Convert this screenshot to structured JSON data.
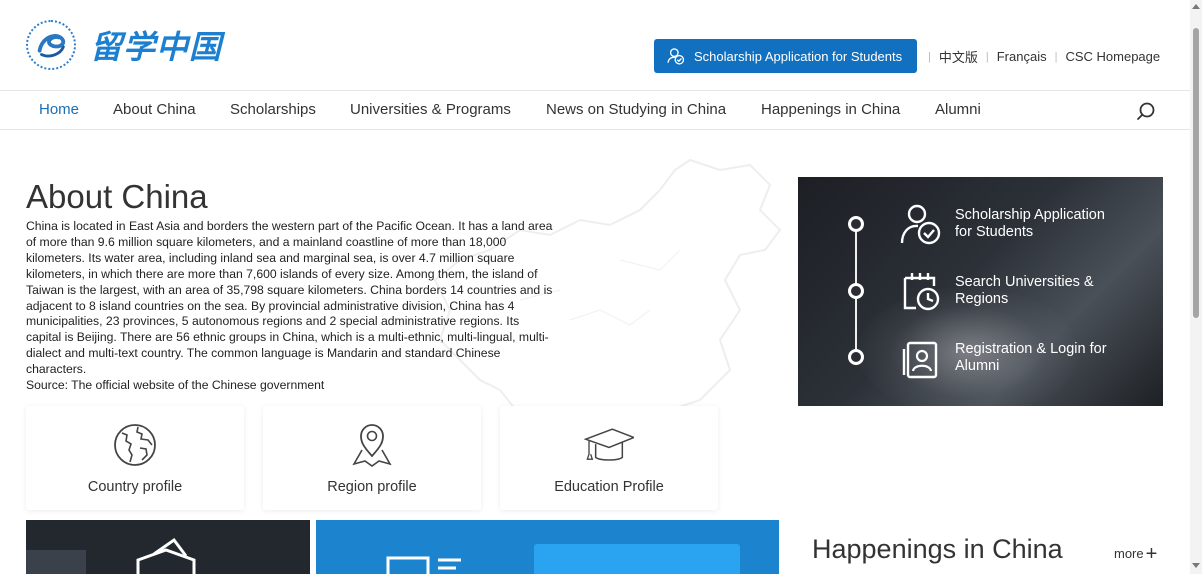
{
  "header": {
    "logo_text": "留学中国",
    "apply_button": "Scholarship Application for Students",
    "languages": [
      "中文版",
      "Français",
      "CSC Homepage"
    ]
  },
  "nav": {
    "items": [
      "Home",
      "About China",
      "Scholarships",
      "Universities & Programs",
      "News on Studying in China",
      "Happenings in China",
      "Alumni"
    ],
    "active": "Home"
  },
  "about": {
    "title": "About China",
    "body": "China is located in East Asia and borders the western part of the Pacific Ocean. It has a land area of more than 9.6 million square kilometers, and a mainland coastline of more than 18,000 kilometers. Its water area, including inland sea and marginal sea, is over 4.7 million square kilometers, in which there are more than 7,600 islands of every size. Among them, the island of Taiwan is the largest, with an area of 35,798 square kilometers. China borders 14 countries and is adjacent to 8 island countries on the sea. By provincial administrative division, China has 4 municipalities, 23 provinces, 5 autonomous regions and 2 special administrative regions. Its capital is Beijing. There are 56 ethnic groups in China, which is a multi-ethnic, multi-lingual, multi-dialect and multi-text country. The common language is Mandarin and standard Chinese characters.",
    "source": "Source: The official website of the Chinese government"
  },
  "profiles": [
    {
      "label": "Country profile",
      "icon": "globe-icon"
    },
    {
      "label": "Region profile",
      "icon": "map-pin-icon"
    },
    {
      "label": "Education Profile",
      "icon": "graduation-cap-icon"
    }
  ],
  "quick_links": [
    {
      "label": "Scholarship Application for Students",
      "icon": "user-check-icon"
    },
    {
      "label": "Search Universities & Regions",
      "icon": "calendar-clock-icon"
    },
    {
      "label": "Registration & Login for Alumni",
      "icon": "id-card-icon"
    }
  ],
  "happenings": {
    "title": "Happenings in China",
    "more": "more"
  },
  "colors": {
    "brand_blue": "#1170c0",
    "nav_active": "#1a6fb6",
    "tile_blue": "#1c84cf"
  }
}
